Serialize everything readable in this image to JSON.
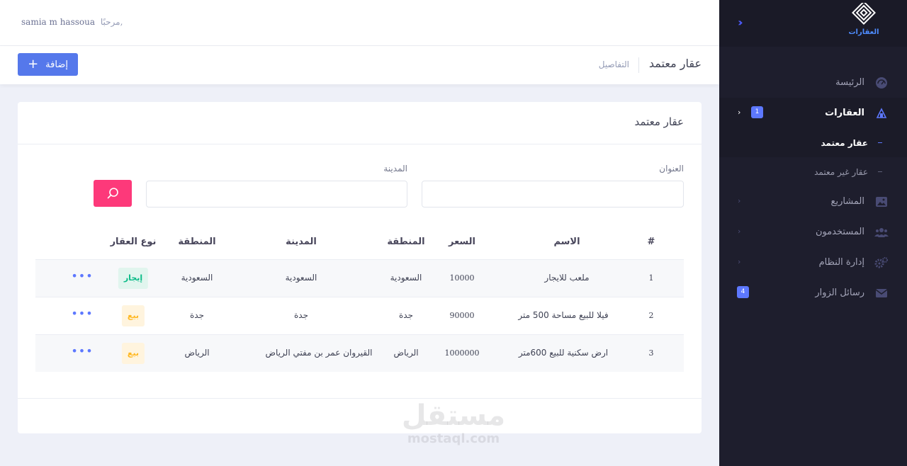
{
  "brand": {
    "logo_text": "العقارات"
  },
  "header": {
    "greeting": "مرحبًا,",
    "user_name": "samia m hassoua"
  },
  "subheader": {
    "title": "عقار معتمد",
    "breadcrumb": "التفاصيل",
    "add_button": "إضافة"
  },
  "sidebar": {
    "items": [
      {
        "label": "الرئيسة",
        "icon": "dashboard-icon"
      },
      {
        "label": "العقارات",
        "icon": "buildings-icon",
        "badge": "1",
        "active": true,
        "children": [
          {
            "label": "عقار معتمد",
            "active": true
          },
          {
            "label": "عقار غير معتمد",
            "active": false
          }
        ]
      },
      {
        "label": "المشاريع",
        "icon": "image-icon"
      },
      {
        "label": "المستخدمون",
        "icon": "users-icon"
      },
      {
        "label": "إدارة النظام",
        "icon": "gears-icon"
      },
      {
        "label": "رسائل الزوار",
        "icon": "envelope-icon",
        "badge": "4"
      }
    ]
  },
  "card": {
    "title": "عقار معتمد",
    "filters": {
      "title_label": "العنوان",
      "city_label": "المدينة",
      "title_value": "",
      "city_value": ""
    }
  },
  "table": {
    "headers": [
      "#",
      "الاسم",
      "السعر",
      "المنطقة",
      "المدينة",
      "المنطقة",
      "نوع العقار"
    ],
    "rows": [
      {
        "index": "1",
        "name": "ملعب للايجار",
        "price": "10000",
        "region": "السعودية",
        "city": "السعودية",
        "area": "السعودية",
        "type": "إيجار",
        "type_kind": "rent"
      },
      {
        "index": "2",
        "name": "فيلا للبيع مساحة 500 متر",
        "price": "90000",
        "region": "جدة",
        "city": "جدة",
        "area": "جدة",
        "type": "بيع",
        "type_kind": "sale"
      },
      {
        "index": "3",
        "name": "ارض سكنية للبيع 600متر",
        "price": "1000000",
        "region": "الرياض",
        "city": "القيروان عمر بن مفتي الرياض",
        "area": "الرياض",
        "type": "بيع",
        "type_kind": "sale"
      }
    ],
    "row_actions": "•••"
  },
  "watermark": {
    "arabic": "مستقل",
    "latin": "mostaql.com"
  },
  "colors": {
    "primary": "#5578eb",
    "danger": "#fd397a",
    "sidebar": "#1e1e2d"
  }
}
